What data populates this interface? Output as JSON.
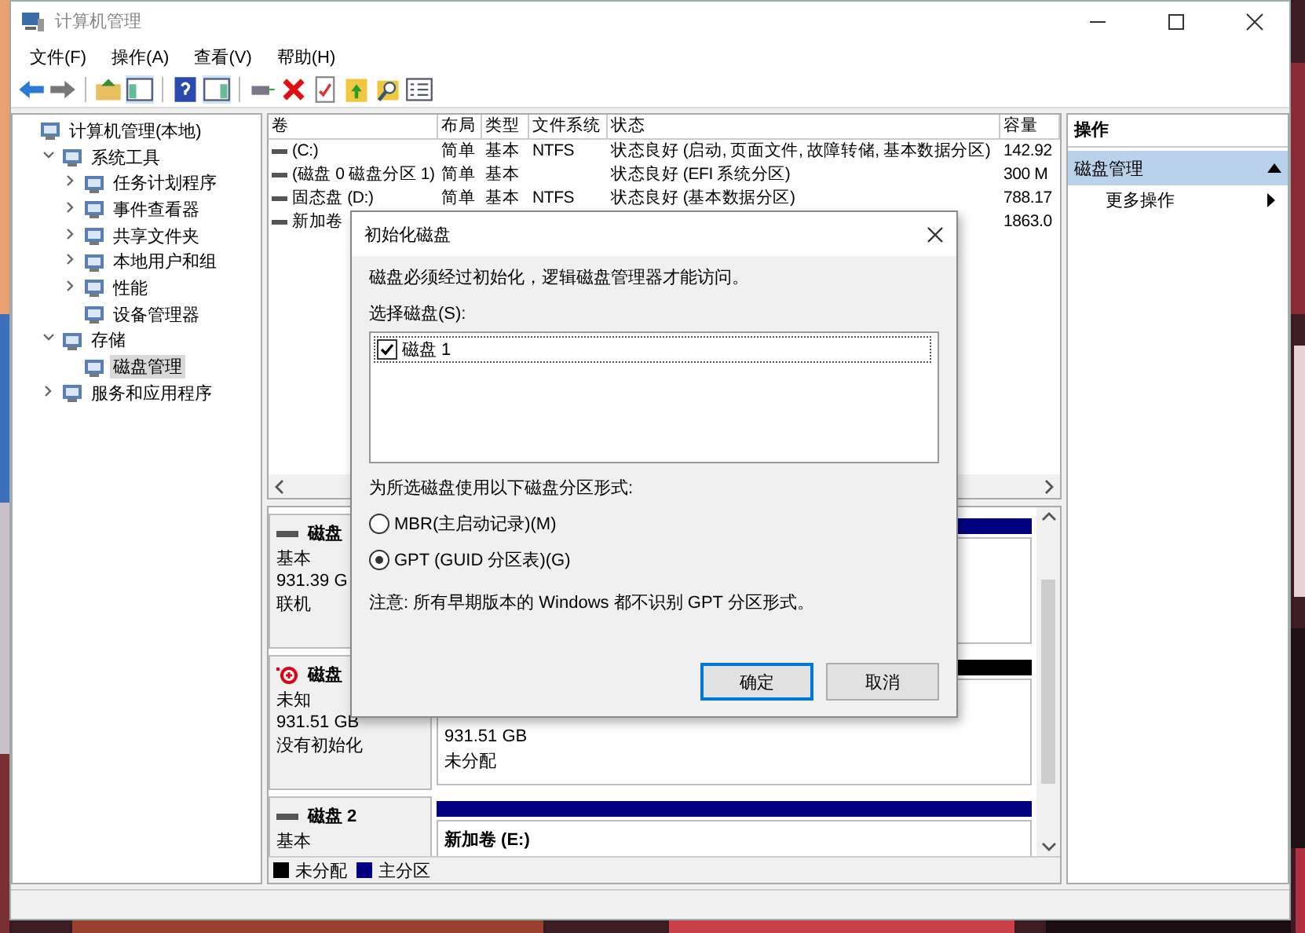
{
  "window": {
    "title": "计算机管理"
  },
  "menu": [
    "文件(F)",
    "操作(A)",
    "查看(V)",
    "帮助(H)"
  ],
  "tree": [
    {
      "label": "计算机管理(本地)",
      "selected": false,
      "children": [
        {
          "label": "系统工具",
          "expanded": true,
          "selected": false,
          "children": [
            {
              "label": "任务计划程序",
              "expanded": false,
              "selected": false
            },
            {
              "label": "事件查看器",
              "expanded": false,
              "selected": false
            },
            {
              "label": "共享文件夹",
              "expanded": false,
              "selected": false
            },
            {
              "label": "本地用户和组",
              "expanded": false,
              "selected": false
            },
            {
              "label": "性能",
              "expanded": false,
              "selected": false
            },
            {
              "label": "设备管理器",
              "selected": false
            }
          ]
        },
        {
          "label": "存储",
          "expanded": true,
          "selected": false,
          "children": [
            {
              "label": "磁盘管理",
              "selected": true
            }
          ]
        },
        {
          "label": "服务和应用程序",
          "expanded": false,
          "selected": false
        }
      ]
    }
  ],
  "volume_table": {
    "columns": [
      "卷",
      "布局",
      "类型",
      "文件系统",
      "状态",
      "容量"
    ],
    "rows": [
      {
        "volume": "(C:)",
        "layout": "简单",
        "type": "基本",
        "filesystem": "NTFS",
        "status": "状态良好 (启动, 页面文件, 故障转储, 基本数据分区)",
        "capacity": "142.92"
      },
      {
        "volume": "(磁盘 0 磁盘分区 1)",
        "layout": "简单",
        "type": "基本",
        "status": "状态良好 (EFI 系统分区)",
        "capacity": "300 M"
      },
      {
        "volume": "固态盘 (D:)",
        "layout": "简单",
        "type": "基本",
        "filesystem": "NTFS",
        "status": "状态良好 (基本数据分区)",
        "capacity": "788.17"
      },
      {
        "volume": "新加卷",
        "capacity": "1863.0"
      }
    ]
  },
  "disks": [
    {
      "name": "磁盘",
      "error": false,
      "details": [
        "基本",
        "931.39 G",
        "联机"
      ],
      "partitions": [
        {
          "kind": "primary"
        }
      ]
    },
    {
      "name": "磁盘",
      "error": true,
      "details": [
        "未知",
        "931.51 GB",
        "没有初始化"
      ],
      "partitions": [
        {
          "kind": "unallocated",
          "lines": [
            "931.51 GB",
            "未分配"
          ]
        }
      ]
    },
    {
      "name": "磁盘 2",
      "error": false,
      "details": [
        "基本"
      ],
      "partitions": [
        {
          "kind": "primary",
          "title": "新加卷 (E:)"
        }
      ]
    }
  ],
  "legend": [
    {
      "label": "未分配",
      "color": "#000000"
    },
    {
      "label": "主分区",
      "color": "#000080"
    }
  ],
  "actions": {
    "header": "操作",
    "section": {
      "label": "磁盘管理",
      "expanded": true
    },
    "items": [
      "更多操作"
    ]
  },
  "dialog": {
    "title": "初始化磁盘",
    "message": "磁盘必须经过初始化，逻辑磁盘管理器才能访问。",
    "select_label": "选择磁盘(S):",
    "disks": [
      {
        "label": "磁盘 1",
        "checked": true,
        "selected": true
      }
    ],
    "style_label": "为所选磁盘使用以下磁盘分区形式:",
    "options": [
      {
        "label": "MBR(主启动记录)(M)",
        "selected": false
      },
      {
        "label": "GPT (GUID 分区表)(G)",
        "selected": true
      }
    ],
    "note": "注意: 所有早期版本的 Windows 都不识别 GPT 分区形式。",
    "buttons": [
      {
        "label": "确定",
        "default": true
      },
      {
        "label": "取消",
        "default": false
      }
    ]
  }
}
